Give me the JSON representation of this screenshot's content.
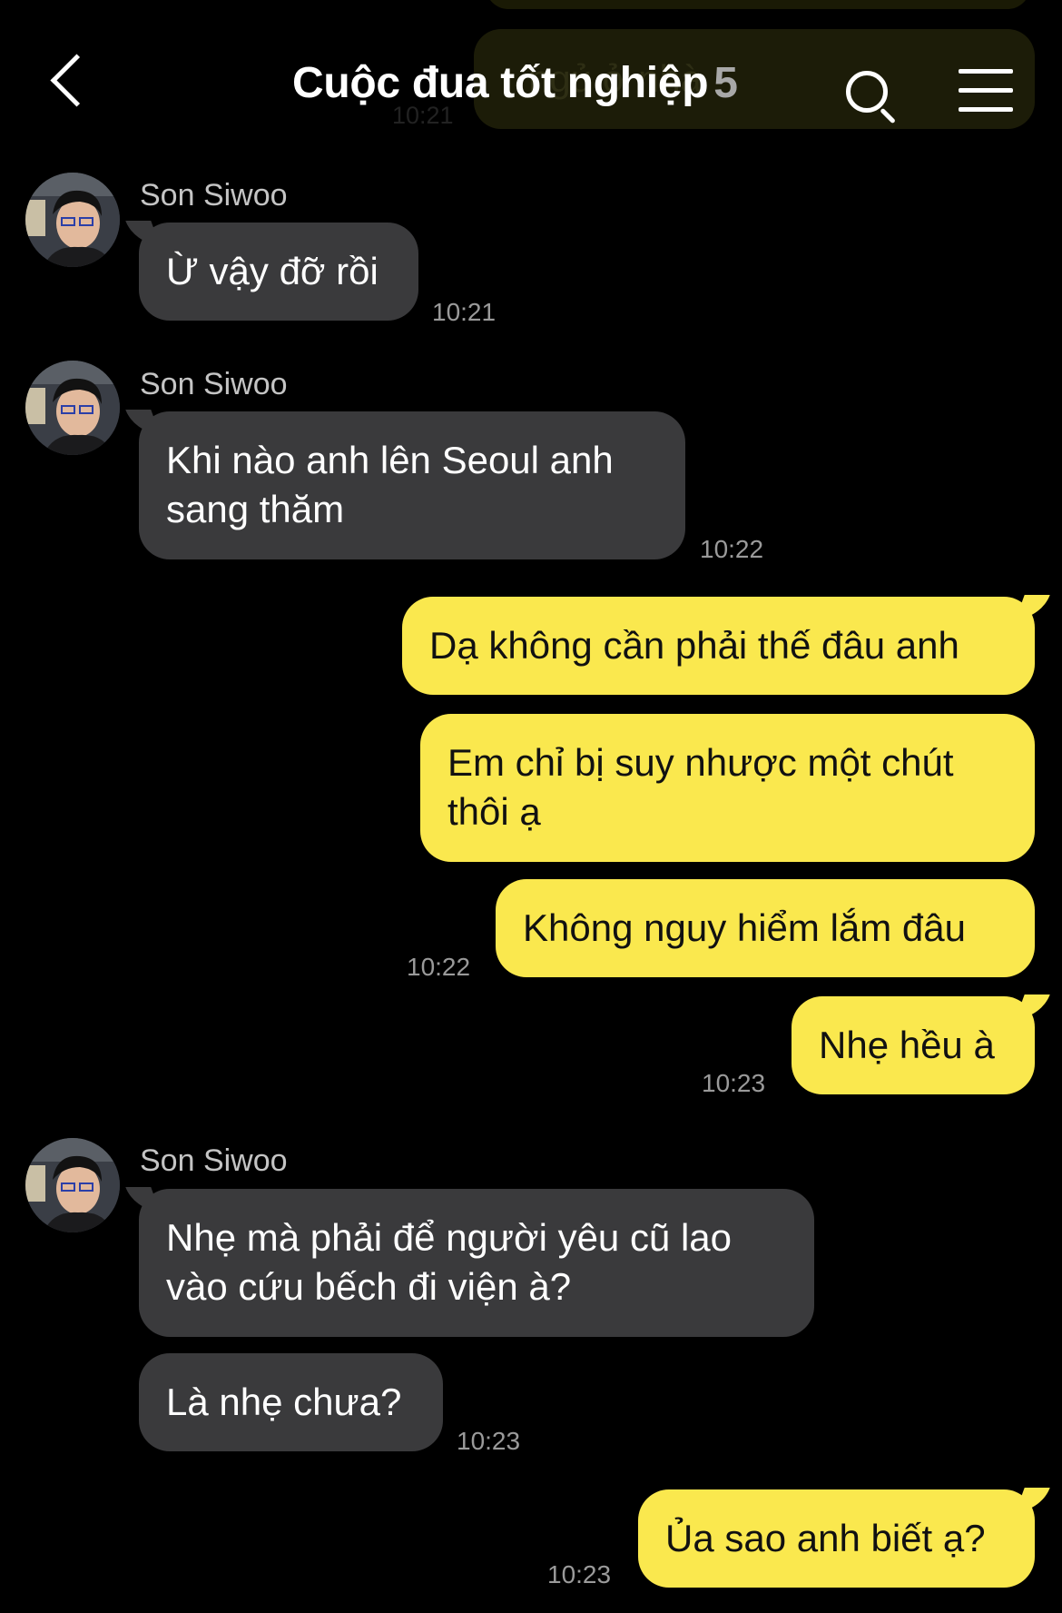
{
  "header": {
    "title": "Cuộc đua tốt nghiệp",
    "member_count": "5",
    "back_icon": "chevron-left-icon",
    "search_icon": "search-icon",
    "menu_icon": "hamburger-menu-icon"
  },
  "background": {
    "ghost_text": "ngủ ở nhà",
    "ghost_time": "10:21"
  },
  "colors": {
    "background": "#000000",
    "incoming_bubble": "#3a3a3c",
    "outgoing_bubble": "#fae84e",
    "timestamp": "#9a9a9a"
  },
  "messages": [
    {
      "sender": "Son Siwoo",
      "text": "Ừ vậy đỡ rồi",
      "time": "10:21"
    },
    {
      "sender": "Son Siwoo",
      "line1": "Khi nào anh lên Seoul anh",
      "line2": "sang thăm",
      "time": "10:22"
    },
    {
      "text": "Dạ không cần phải thế đâu anh"
    },
    {
      "line1": "Em chỉ bị suy nhược một chút",
      "line2": "thôi ạ"
    },
    {
      "text": "Không nguy hiểm lắm đâu",
      "time": "10:22"
    },
    {
      "text": "Nhẹ hều à",
      "time": "10:23"
    },
    {
      "sender": "Son Siwoo",
      "line1": "Nhẹ mà phải để người yêu cũ lao",
      "line2": "vào cứu bếch đi viện à?"
    },
    {
      "text": "Là nhẹ chưa?",
      "time": "10:23"
    },
    {
      "text": "Ủa sao anh biết ạ?",
      "time": "10:23"
    }
  ]
}
